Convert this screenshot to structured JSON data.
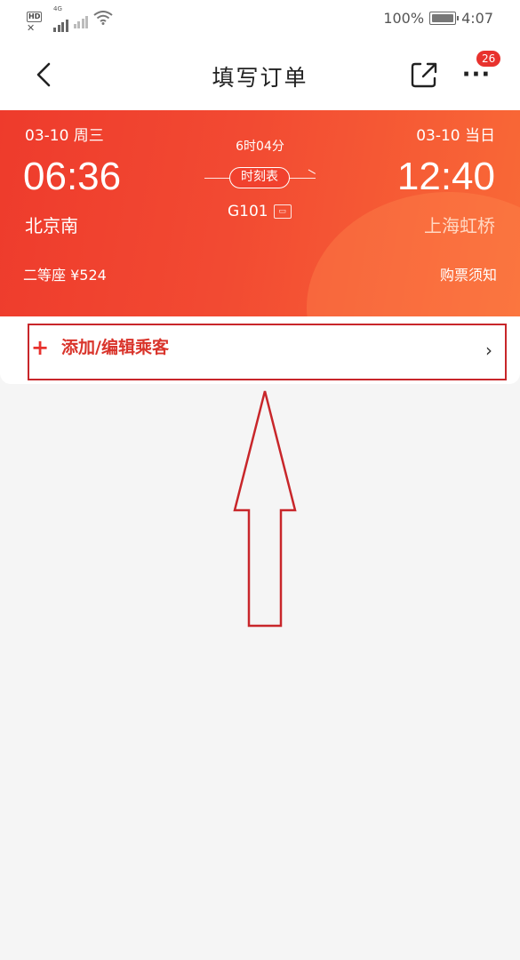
{
  "status_bar": {
    "hd_label": "HD",
    "network_label": "4G",
    "battery_percent": "100%",
    "battery_level": 1.0,
    "time": "4:07"
  },
  "nav": {
    "title": "填写订单",
    "badge_count": "26"
  },
  "ticket": {
    "departure_date": "03-10 周三",
    "arrival_date": "03-10 当日",
    "departure_time": "06:36",
    "arrival_time": "12:40",
    "duration": "6时04分",
    "timetable_label": "时刻表",
    "train_number": "G101",
    "departure_station": "北京南",
    "arrival_station": "上海虹桥",
    "seat_price": "二等座 ¥524",
    "notice_label": "购票须知"
  },
  "passenger": {
    "add_label": "添加/编辑乘客"
  },
  "colors": {
    "accent": "#e8322e",
    "annotation": "#c8262a"
  }
}
